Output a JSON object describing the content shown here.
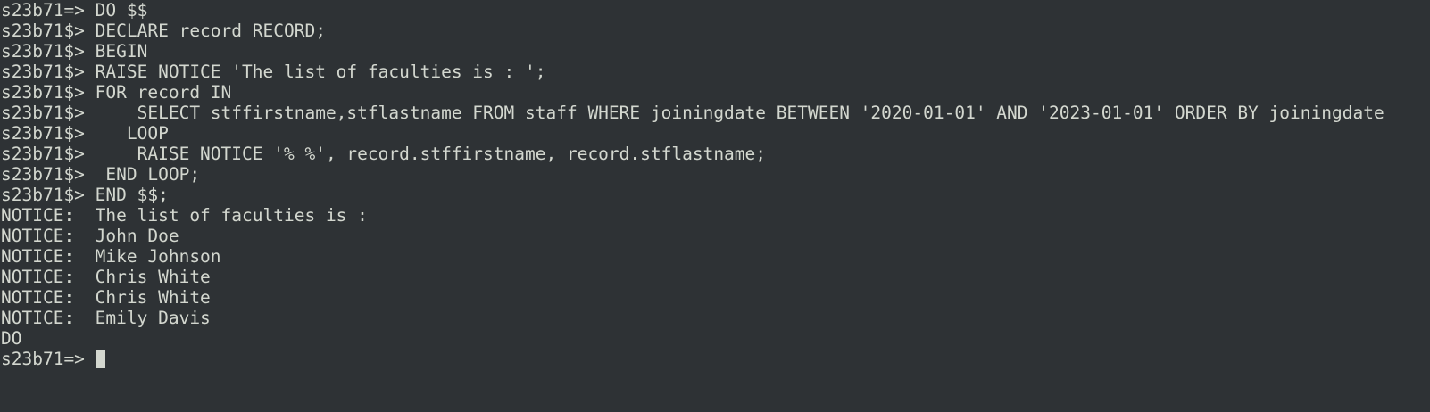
{
  "terminal": {
    "lines": [
      "s23b71=> DO $$",
      "s23b71$> DECLARE record RECORD;",
      "s23b71$> BEGIN",
      "s23b71$> RAISE NOTICE 'The list of faculties is : ';",
      "s23b71$> FOR record IN",
      "s23b71$>     SELECT stffirstname,stflastname FROM staff WHERE joiningdate BETWEEN '2020-01-01' AND '2023-01-01' ORDER BY joiningdate",
      "s23b71$>    LOOP",
      "s23b71$>     RAISE NOTICE '% %', record.stffirstname, record.stflastname;",
      "s23b71$>  END LOOP;",
      "s23b71$> END $$;",
      "NOTICE:  The list of faculties is :",
      "NOTICE:  John Doe",
      "NOTICE:  Mike Johnson",
      "NOTICE:  Chris White",
      "NOTICE:  Chris White",
      "NOTICE:  Emily Davis",
      "DO"
    ],
    "prompt": "s23b71=> "
  },
  "colors": {
    "background": "#2e3235",
    "foreground": "#d3d7cf",
    "cursor": "#d3d7cf"
  }
}
